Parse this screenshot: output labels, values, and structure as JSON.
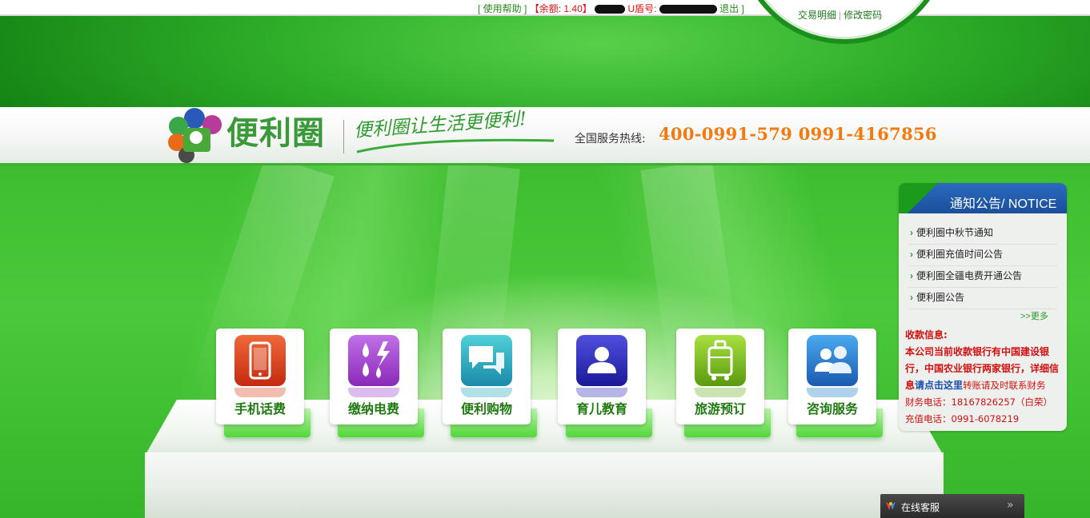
{
  "topbar": {
    "help": "使用帮助",
    "balance_label": "余额:",
    "balance_value": "1.40",
    "ukey_label": "U盾号:",
    "logout": "退出",
    "transaction_details": "交易明细",
    "change_password": "修改密码"
  },
  "header": {
    "logo_text": "便利圈",
    "slogan": "便利圈让生活更便利!",
    "hotline_label": "全国服务热线:",
    "hotline_numbers": "400-0991-579 0991-4167856"
  },
  "services": [
    {
      "label": "手机话费",
      "icon": "mobile-phone-icon",
      "color": "#d9401a"
    },
    {
      "label": "缴纳电费",
      "icon": "electricity-water-icon",
      "color": "#9a3fc8"
    },
    {
      "label": "便利购物",
      "icon": "chat-bubbles-icon",
      "color": "#20a8b8"
    },
    {
      "label": "育儿教育",
      "icon": "person-icon",
      "color": "#2a2ab8"
    },
    {
      "label": "旅游预订",
      "icon": "luggage-icon",
      "color": "#6ab020"
    },
    {
      "label": "咨询服务",
      "icon": "users-icon",
      "color": "#1a7ac8"
    }
  ],
  "notice": {
    "title": "通知公告/ NOTICE",
    "items": [
      "便利圈中秋节通知",
      "便利圈充值时间公告",
      "便利圈全疆电费开通公告",
      "便利圈公告"
    ],
    "more": ">>更多",
    "payment_title": "收款信息:",
    "payment_text_1": "本公司当前收款银行有中国建设银行，中国农业银行两家银行，详细信息",
    "payment_link": "请点击这里",
    "payment_text_2": "转账请及时联系财务",
    "finance_phone": "财务电话：18167826257（白荣）",
    "recharge_phone": "充值电话：0991-6078219"
  },
  "online_service": {
    "label": "在线客服"
  },
  "colors": {
    "brand_green": "#3a9a3a",
    "hotline_orange": "#f47a10",
    "notice_blue": "#1b4f9a",
    "alert_red": "#d01010"
  }
}
